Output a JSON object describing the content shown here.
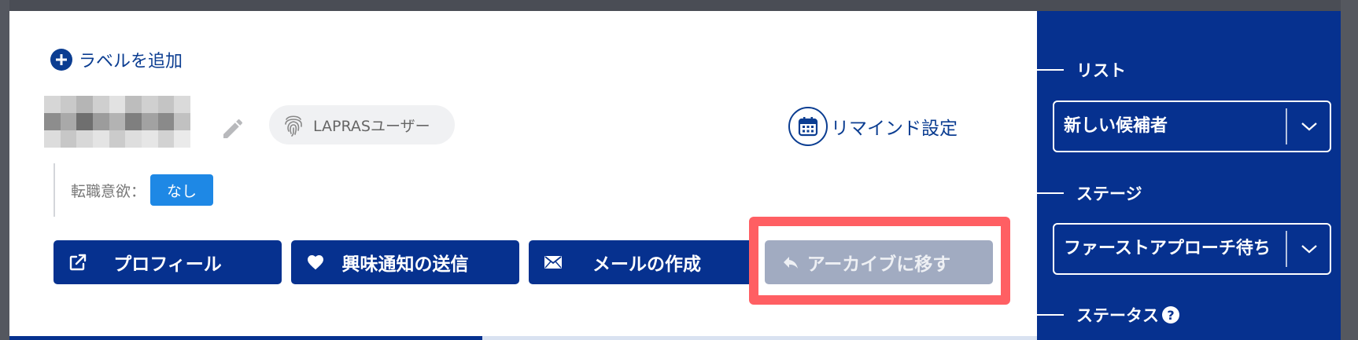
{
  "header": {
    "add_label": "ラベルを追加"
  },
  "candidate": {
    "badge_label": "LAPRASユーザー",
    "motivation_label": "転職意欲：",
    "motivation_value": "なし"
  },
  "remind": {
    "label": "リマインド設定"
  },
  "actions": {
    "profile": "プロフィール",
    "interest": "興味通知の送信",
    "mail": "メールの作成",
    "archive": "アーカイブに移す"
  },
  "sidebar": {
    "list_heading": "リスト",
    "list_value": "新しい候補者",
    "stage_heading": "ステージ",
    "stage_value": "ファーストアプローチ待ち",
    "status_heading": "ステータス",
    "help_glyph": "?"
  },
  "progress": {
    "fraction": 0.46
  },
  "colors": {
    "primary": "#06318f",
    "highlight_frame": "#ff5f63",
    "disabled_button": "#a1abc1",
    "badge_blue": "#1e88e5"
  },
  "icons": {
    "add": "plus-circle-icon",
    "edit": "pencil-icon",
    "fingerprint": "fingerprint-icon",
    "calendar": "calendar-icon",
    "external_link": "external-link-icon",
    "heart": "heart-icon",
    "mail": "envelope-icon",
    "reply": "reply-arrow-icon",
    "chevron": "chevron-down-icon",
    "help": "question-circle-icon"
  }
}
